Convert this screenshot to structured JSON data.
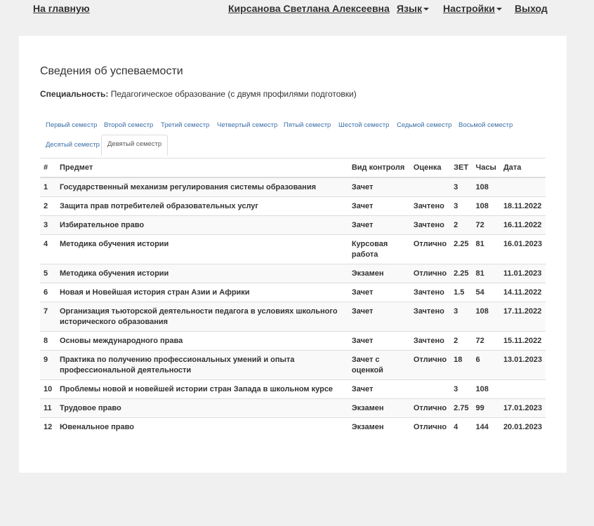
{
  "nav": {
    "home": "На главную",
    "user": "Кирсанова Светлана Алексеевна",
    "language": "Язык",
    "settings": "Настройки",
    "logout": "Выход"
  },
  "page": {
    "title": "Сведения об успеваемости",
    "specialty_label": "Специальность:",
    "specialty_value": "Педагогическое образование (с двумя профилями подготовки)"
  },
  "tabs": [
    {
      "label": "Первый семестр"
    },
    {
      "label": "Второй семестр"
    },
    {
      "label": "Третий семестр"
    },
    {
      "label": "Четвертый семестр"
    },
    {
      "label": "Пятый семестр"
    },
    {
      "label": "Шестой семестр"
    },
    {
      "label": "Седьмой семестр"
    },
    {
      "label": "Восьмой семестр"
    },
    {
      "label": "Десятый семестр"
    },
    {
      "label": "Девятый семестр",
      "active": true
    }
  ],
  "table": {
    "headers": [
      "#",
      "Предмет",
      "Вид контроля",
      "Оценка",
      "ЗЕТ",
      "Часы",
      "Дата"
    ],
    "rows": [
      [
        "1",
        "Государственный механизм регулирования системы образования",
        "Зачет",
        "",
        "3",
        "108",
        ""
      ],
      [
        "2",
        "Защита прав потребителей образовательных услуг",
        "Зачет",
        "Зачтено",
        "3",
        "108",
        "18.11.2022"
      ],
      [
        "3",
        "Избирательное право",
        "Зачет",
        "Зачтено",
        "2",
        "72",
        "16.11.2022"
      ],
      [
        "4",
        "Методика обучения истории",
        "Курсовая работа",
        "Отлично",
        "2.25",
        "81",
        "16.01.2023"
      ],
      [
        "5",
        "Методика обучения истории",
        "Экзамен",
        "Отлично",
        "2.25",
        "81",
        "11.01.2023"
      ],
      [
        "6",
        "Новая и Новейшая история стран Азии и Африки",
        "Зачет",
        "Зачтено",
        "1.5",
        "54",
        "14.11.2022"
      ],
      [
        "7",
        "Организация тьюторской деятельности педагога в условиях школьного исторического образования",
        "Зачет",
        "Зачтено",
        "3",
        "108",
        "17.11.2022"
      ],
      [
        "8",
        "Основы международного права",
        "Зачет",
        "Зачтено",
        "2",
        "72",
        "15.11.2022"
      ],
      [
        "9",
        "Практика по получению профессиональных умений и опыта профессиональной деятельности",
        "Зачет с оценкой",
        "Отлично",
        "18",
        "6",
        "13.01.2023"
      ],
      [
        "10",
        "Проблемы новой и новейшей истории стран Запада в школьном курсе",
        "Зачет",
        "",
        "3",
        "108",
        ""
      ],
      [
        "11",
        "Трудовое право",
        "Экзамен",
        "Отлично",
        "2.75",
        "99",
        "17.01.2023"
      ],
      [
        "12",
        "Ювенальное право",
        "Экзамен",
        "Отлично",
        "4",
        "144",
        "20.01.2023"
      ]
    ]
  }
}
